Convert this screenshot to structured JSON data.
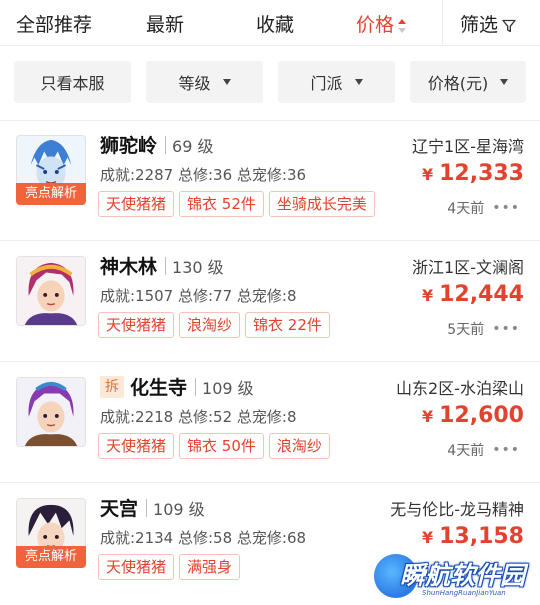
{
  "sort_tabs": [
    {
      "label": "全部推荐",
      "active": false
    },
    {
      "label": "最新",
      "active": false
    },
    {
      "label": "收藏",
      "active": false
    },
    {
      "label": "价格",
      "active": true
    },
    {
      "label": "筛选",
      "active": false
    }
  ],
  "filters": [
    {
      "label": "只看本服"
    },
    {
      "label": "等级"
    },
    {
      "label": "门派"
    },
    {
      "label": "价格(元)"
    }
  ],
  "listings": [
    {
      "school": "狮驼岭",
      "level": "69 级",
      "badge": "亮点解析",
      "split": "",
      "stats": "成就:2287 总修:36 总宠修:36",
      "tags": [
        "天使猪猪",
        "锦衣 52件",
        "坐骑成长完美"
      ],
      "server": "辽宁1区-星海湾",
      "currency": "¥",
      "price": "12,333",
      "time": "4天前"
    },
    {
      "school": "神木林",
      "level": "130 级",
      "badge": "",
      "split": "",
      "stats": "成就:1507 总修:77 总宠修:8",
      "tags": [
        "天使猪猪",
        "浪淘纱",
        "锦衣 22件"
      ],
      "server": "浙江1区-文澜阁",
      "currency": "¥",
      "price": "12,444",
      "time": "5天前"
    },
    {
      "school": "化生寺",
      "level": "109 级",
      "badge": "",
      "split": "拆",
      "stats": "成就:2218 总修:52 总宠修:8",
      "tags": [
        "天使猪猪",
        "锦衣 50件",
        "浪淘纱"
      ],
      "server": "山东2区-水泊梁山",
      "currency": "¥",
      "price": "12,600",
      "time": "4天前"
    },
    {
      "school": "天宫",
      "level": "109 级",
      "badge": "亮点解析",
      "split": "",
      "stats": "成就:2134 总修:58 总宠修:68",
      "tags": [
        "天使猪猪",
        "满强身"
      ],
      "server": "无与伦比-龙马精神",
      "currency": "¥",
      "price": "13,158",
      "time": ""
    }
  ],
  "watermark": {
    "title": "瞬航软件园",
    "subtitle": "ShunHangRuanJianYuan"
  },
  "colors": {
    "accent": "#e1432f",
    "badge": "#f0633c"
  }
}
